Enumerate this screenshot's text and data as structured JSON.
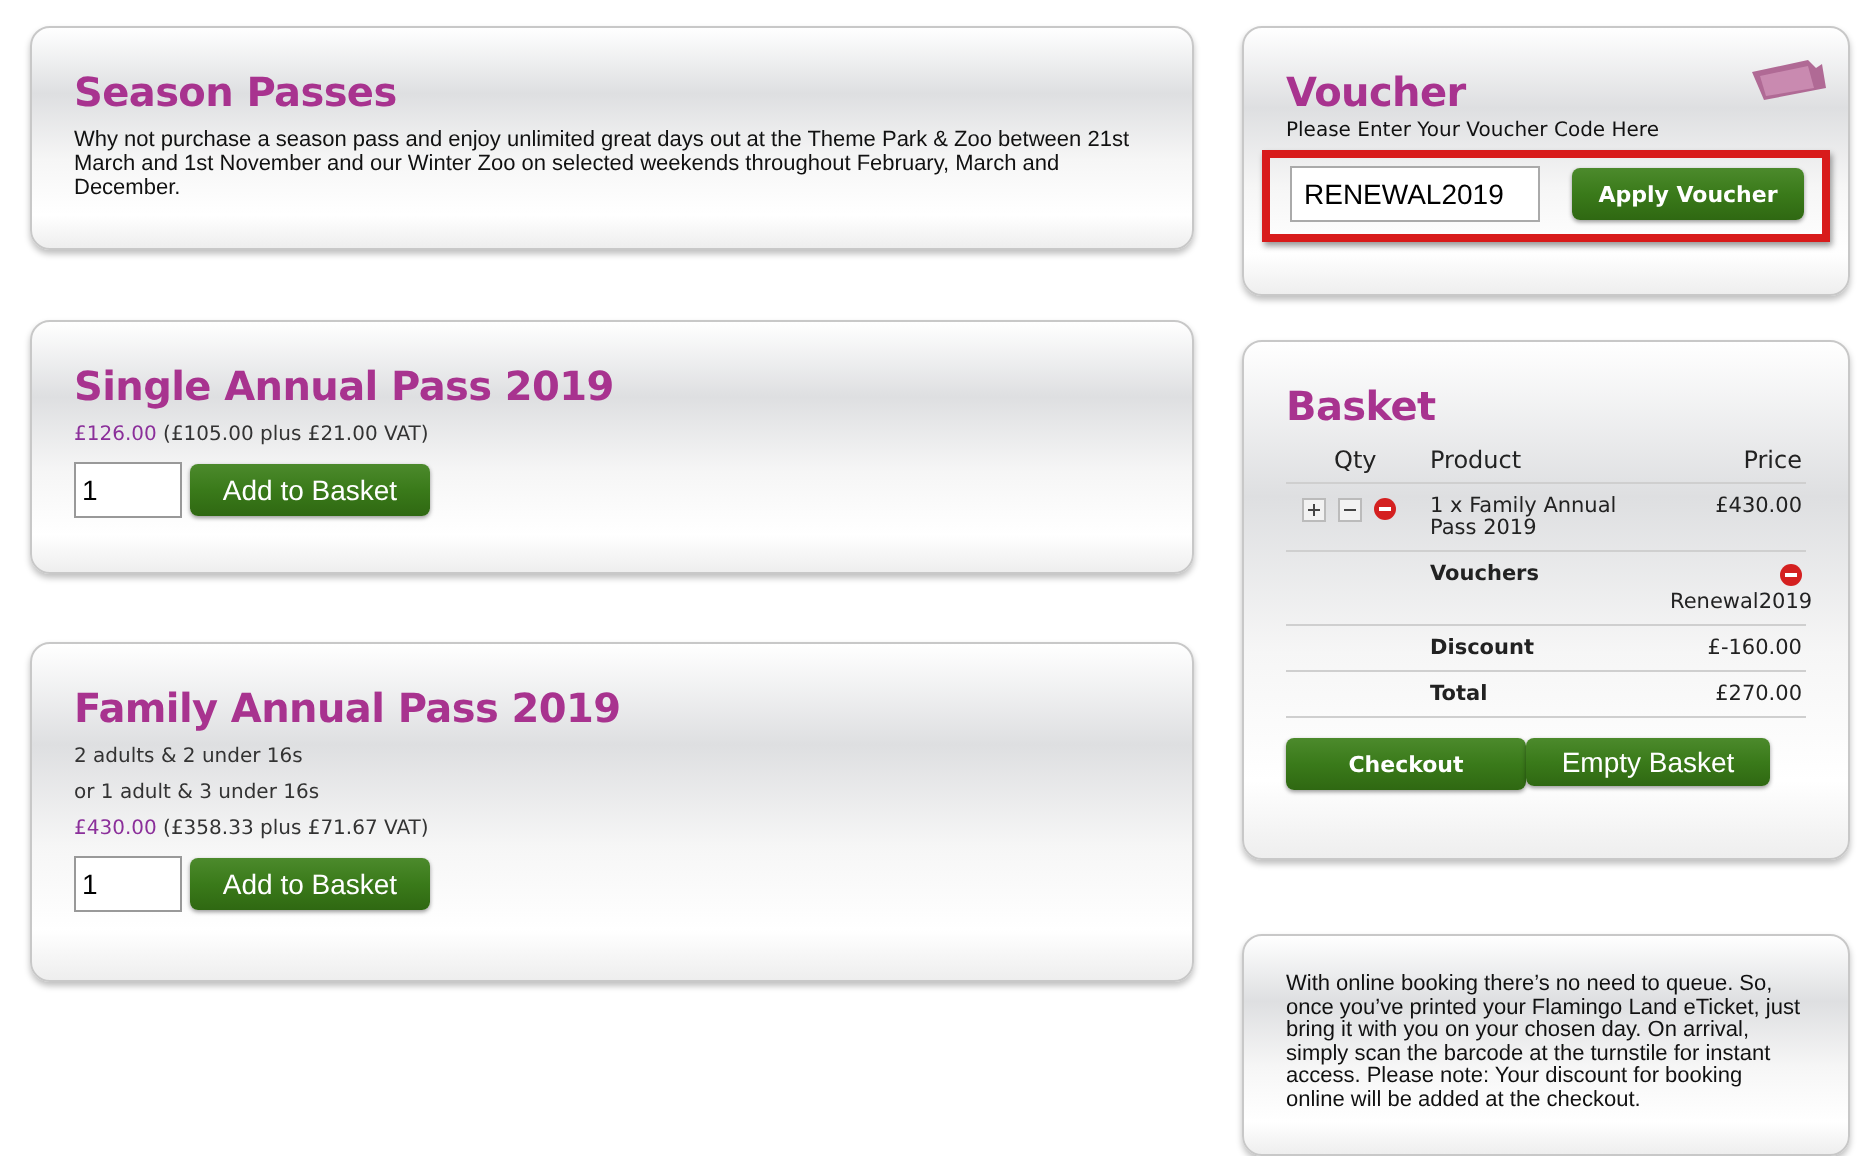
{
  "season": {
    "title": "Season Passes",
    "description": "Why not purchase a season pass and enjoy unlimited great days out at the Theme Park & Zoo between 21st March and 1st November and our Winter Zoo on selected weekends throughout February, March and December."
  },
  "products": [
    {
      "title": "Single Annual Pass 2019",
      "price": "£126.00",
      "price_breakdown": "(£105.00 plus £21.00 VAT)",
      "quantity": "1",
      "button": "Add to Basket"
    },
    {
      "title": "Family Annual Pass 2019",
      "details": [
        "2 adults & 2 under 16s",
        "or 1 adult & 3 under 16s"
      ],
      "price": "£430.00",
      "price_breakdown": "(£358.33 plus £71.67 VAT)",
      "quantity": "1",
      "button": "Add to Basket"
    }
  ],
  "voucher": {
    "title": "Voucher",
    "instruction": "Please Enter Your Voucher Code Here",
    "code": "RENEWAL2019",
    "button": "Apply Voucher",
    "highlighted": true
  },
  "basket": {
    "title": "Basket",
    "columns": [
      "Qty",
      "Product",
      "Price"
    ],
    "items": [
      {
        "product": "1 x Family Annual Pass 2019",
        "price": "£430.00"
      }
    ],
    "vouchers": {
      "label": "Vouchers",
      "code": "Renewal2019"
    },
    "summary": [
      {
        "label": "Discount",
        "value": "£-160.00"
      },
      {
        "label": "Total",
        "value": "£270.00"
      }
    ],
    "buttons": [
      {
        "label": "Checkout",
        "kind": "small"
      },
      {
        "label": "Empty Basket",
        "kind": "large"
      }
    ]
  },
  "info": "With online booking there’s no need to queue. So, once you’ve printed your Flamingo Land eTicket, just bring it with you on your chosen day. On arrival, simply scan the barcode at the turnstile for instant access. Please note: Your discount for booking online will be added at the checkout."
}
